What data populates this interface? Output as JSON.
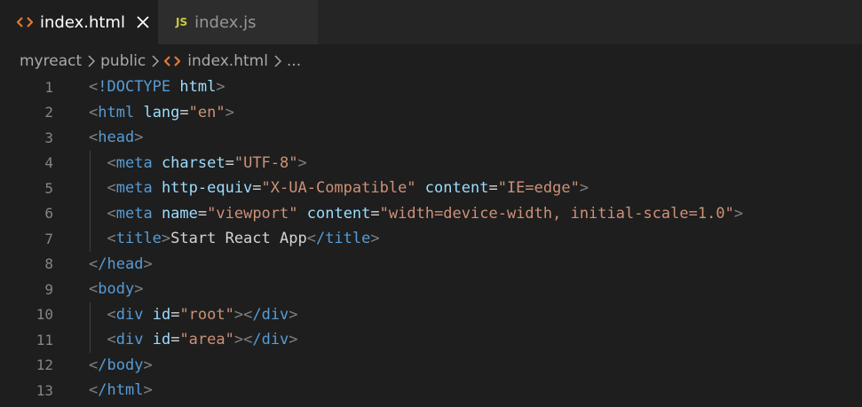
{
  "tabs": [
    {
      "label": "index.html",
      "icon": "html-file-icon",
      "active": true
    },
    {
      "label": "index.js",
      "icon": "js-file-icon",
      "active": false,
      "icon_text": "JS"
    }
  ],
  "breadcrumb": {
    "items": [
      "myreact",
      "public"
    ],
    "file": "index.html",
    "ellipsis": "..."
  },
  "colors": {
    "html_icon": "#e37933",
    "js_icon": "#cbcb41",
    "tag": "#569cd6",
    "attr": "#9cdcfe",
    "string": "#ce9178",
    "bracket": "#808080"
  },
  "editor": {
    "line_numbers": [
      "1",
      "2",
      "3",
      "4",
      "5",
      "6",
      "7",
      "8",
      "9",
      "10",
      "11",
      "12",
      "13"
    ],
    "lines": {
      "l1": {
        "doctype": "!DOCTYPE",
        "html": "html"
      },
      "l2": {
        "tag": "html",
        "attr": "lang",
        "val": "\"en\""
      },
      "l3": {
        "tag": "head"
      },
      "l4": {
        "tag": "meta",
        "attr": "charset",
        "val": "\"UTF-8\""
      },
      "l5": {
        "tag": "meta",
        "attr1": "http-equiv",
        "val1": "\"X-UA-Compatible\"",
        "attr2": "content",
        "val2": "\"IE=edge\""
      },
      "l6": {
        "tag": "meta",
        "attr1": "name",
        "val1": "\"viewport\"",
        "attr2": "content",
        "val2": "\"width=device-width, initial-scale=1.0\""
      },
      "l7": {
        "tag": "title",
        "text": "Start React App",
        "close": "/title"
      },
      "l8": {
        "tag": "/head"
      },
      "l9": {
        "tag": "body"
      },
      "l10": {
        "tag": "div",
        "attr": "id",
        "val": "\"root\"",
        "close": "/div"
      },
      "l11": {
        "tag": "div",
        "attr": "id",
        "val": "\"area\"",
        "close": "/div"
      },
      "l12": {
        "tag": "/body"
      },
      "l13": {
        "tag": "/html"
      }
    }
  }
}
